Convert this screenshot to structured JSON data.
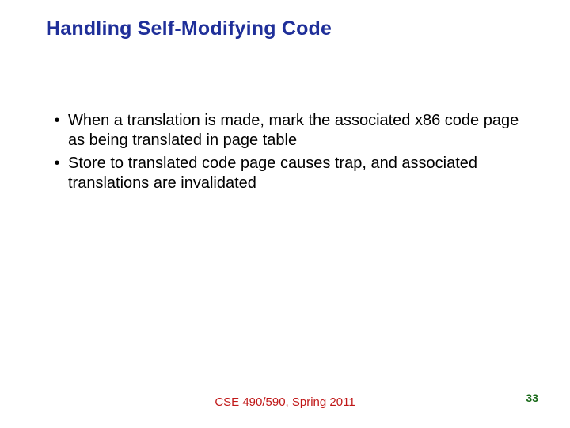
{
  "title": "Handling Self-Modifying Code",
  "bullets": [
    "When a translation is made, mark the associated x86 code page as being translated in page table",
    "Store to translated code page causes trap, and associated translations are invalidated"
  ],
  "footer": "CSE 490/590, Spring 2011",
  "page_number": "33"
}
